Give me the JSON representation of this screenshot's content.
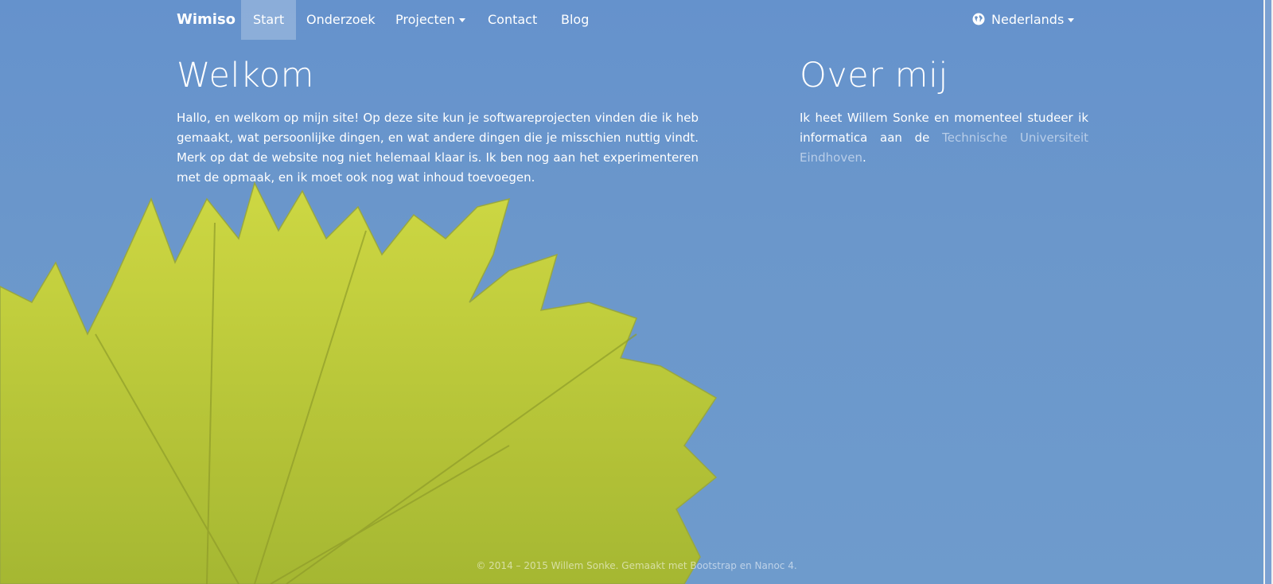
{
  "nav": {
    "brand": "Wimiso",
    "items": [
      {
        "label": "Start",
        "active": true
      },
      {
        "label": "Onderzoek"
      },
      {
        "label": "Projecten",
        "dropdown": true
      },
      {
        "label": "Contact"
      },
      {
        "label": "Blog"
      }
    ],
    "language": {
      "label": "Nederlands",
      "icon": "globe-icon",
      "dropdown": true
    }
  },
  "welcome": {
    "title": "Welkom",
    "text": "Hallo, en welkom op mijn site! Op deze site kun je softwareprojecten vinden die ik heb gemaakt, wat persoonlijke dingen, en wat andere dingen die je misschien nuttig vindt. Merk op dat de website nog niet helemaal klaar is. Ik ben nog aan het experimenteren met de opmaak, en ik moet ook nog wat inhoud toevoegen."
  },
  "about": {
    "title": "Over mij",
    "text_before": "Ik heet Willem Sonke en momenteel studeer ik informatica aan de ",
    "link": "Technische Universiteit Eindhoven",
    "text_after": "."
  },
  "footer": {
    "text": "© 2014 – 2015  Willem Sonke. Gemaakt met Bootstrap en Nanoc 4."
  },
  "colors": {
    "sky": "#6a94c8",
    "leaf": "#c8d63a",
    "link": "#b8cde8"
  }
}
